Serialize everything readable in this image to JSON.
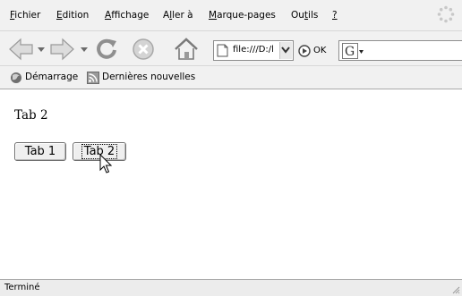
{
  "menubar": {
    "items": [
      {
        "acc": "F",
        "rest": "ichier"
      },
      {
        "acc": "E",
        "rest": "dition"
      },
      {
        "acc": "A",
        "rest": "ffichage"
      },
      {
        "pre": "A",
        "acc": "l",
        "rest": "ler à"
      },
      {
        "acc": "M",
        "rest": "arque-pages"
      },
      {
        "pre": "Ou",
        "acc": "t",
        "rest": "ils"
      },
      {
        "acc": "?",
        "rest": ""
      }
    ]
  },
  "navbar": {
    "url_value": "file:///D:/l",
    "go_label": "OK",
    "search_engine": "G"
  },
  "bookmarks": {
    "items": [
      "Démarrage",
      "Dernières nouvelles"
    ]
  },
  "content": {
    "heading": "Tab 2",
    "buttons": [
      "Tab 1",
      "Tab 2"
    ]
  },
  "status": {
    "text": "Terminé"
  }
}
